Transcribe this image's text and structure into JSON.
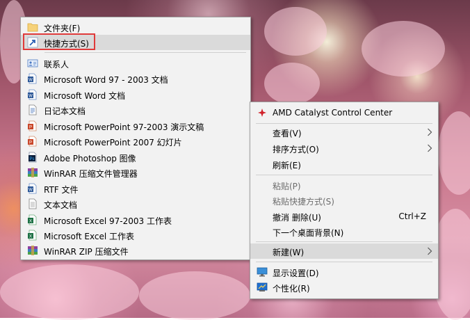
{
  "new_submenu": {
    "items": [
      {
        "label": "文件夹(F)",
        "icon": "folder-icon"
      },
      {
        "label": "快捷方式(S)",
        "icon": "shortcut-icon"
      },
      {
        "label": "联系人",
        "icon": "contact-icon"
      },
      {
        "label": "Microsoft Word 97 - 2003 文档",
        "icon": "word-97-document-icon"
      },
      {
        "label": "Microsoft Word 文档",
        "icon": "word-document-icon"
      },
      {
        "label": "日记本文档",
        "icon": "journal-document-icon"
      },
      {
        "label": "Microsoft PowerPoint 97-2003 演示文稿",
        "icon": "powerpoint-97-presentation-icon"
      },
      {
        "label": "Microsoft PowerPoint 2007 幻灯片",
        "icon": "powerpoint-2007-slide-icon"
      },
      {
        "label": "Adobe Photoshop 图像",
        "icon": "photoshop-image-icon"
      },
      {
        "label": "WinRAR 压缩文件管理器",
        "icon": "winrar-archive-icon"
      },
      {
        "label": "RTF 文件",
        "icon": "rtf-file-icon"
      },
      {
        "label": "文本文档",
        "icon": "text-document-icon"
      },
      {
        "label": "Microsoft Excel 97-2003 工作表",
        "icon": "excel-97-worksheet-icon"
      },
      {
        "label": "Microsoft Excel 工作表",
        "icon": "excel-worksheet-icon"
      },
      {
        "label": "WinRAR ZIP 压缩文件",
        "icon": "winrar-zip-icon"
      }
    ]
  },
  "desktop_menu": {
    "catalyst": {
      "label": "AMD Catalyst Control Center",
      "icon": "amd-catalyst-icon"
    },
    "view": {
      "label": "查看(V)",
      "icon": "chevron-right-icon"
    },
    "sort": {
      "label": "排序方式(O)",
      "icon": "chevron-right-icon"
    },
    "refresh": {
      "label": "刷新(E)"
    },
    "paste": {
      "label": "粘贴(P)"
    },
    "paste_shortcut": {
      "label": "粘贴快捷方式(S)"
    },
    "undo_delete": {
      "label": "撤消 删除(U)",
      "shortcut": "Ctrl+Z"
    },
    "next_background": {
      "label": "下一个桌面背景(N)"
    },
    "new": {
      "label": "新建(W)",
      "icon": "chevron-right-icon"
    },
    "display_settings": {
      "label": "显示设置(D)",
      "icon": "display-settings-icon"
    },
    "personalize": {
      "label": "个性化(R)",
      "icon": "personalize-icon"
    }
  },
  "colors": {
    "menu_bg": "#f2f2f2",
    "hover_bg": "#dadada",
    "disabled_text": "#6d6d6d",
    "annotation_red": "#e03a3a"
  }
}
